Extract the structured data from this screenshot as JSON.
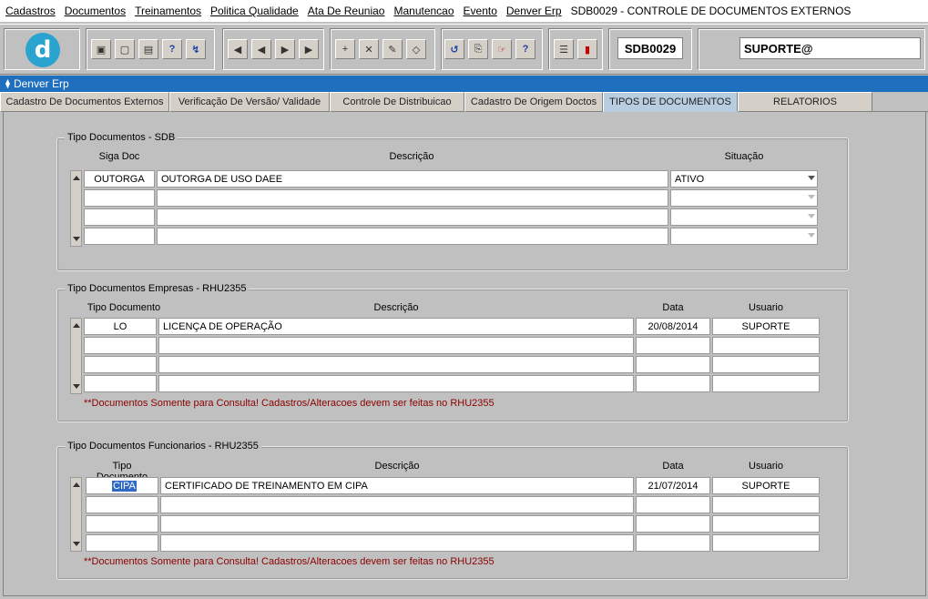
{
  "menu": {
    "items": [
      "Cadastros",
      "Documentos",
      "Treinamentos",
      "Politica Qualidade",
      "Ata De Reuniao",
      "Manutencao",
      "Evento",
      "Denver Erp"
    ],
    "form_title": "SDB0029 - CONTROLE DE DOCUMENTOS EXTERNOS"
  },
  "toolbar": {
    "logo_letter": "d",
    "form_code": "SDB0029",
    "user": "SUPORTE@"
  },
  "window": {
    "title": "Denver Erp"
  },
  "tabs": [
    "Cadastro De Documentos Externos",
    "Verificação De Versão/ Validade",
    "Controle De Distribuicao",
    "Cadastro De Origem Doctos",
    "TIPOS DE DOCUMENTOS",
    "RELATORIOS"
  ],
  "active_tab": "TIPOS DE DOCUMENTOS",
  "sdb": {
    "title": "Tipo Documentos - SDB",
    "headers": {
      "code": "Siga Doc",
      "desc": "Descrição",
      "status": "Situação"
    },
    "rows": [
      {
        "code": "OUTORGA",
        "desc": "OUTORGA DE USO DAEE",
        "status": "ATIVO"
      }
    ]
  },
  "empresas": {
    "title": "Tipo Documentos Empresas - RHU2355",
    "headers": {
      "code": "Tipo Documento",
      "desc": "Descrição",
      "date": "Data",
      "user": "Usuario"
    },
    "rows": [
      {
        "code": "LO",
        "desc": "LICENÇA DE OPERAÇÃO",
        "date": "20/08/2014",
        "user": "SUPORTE"
      }
    ],
    "note": "**Documentos Somente para Consulta! Cadastros/Alteracoes devem ser feitas no RHU2355"
  },
  "funcionarios": {
    "title": "Tipo Documentos Funcionarios - RHU2355",
    "headers": {
      "code": "Tipo Documento",
      "desc": "Descrição",
      "date": "Data",
      "user": "Usuario"
    },
    "rows": [
      {
        "code": "CIPA",
        "desc": "CERTIFICADO DE TREINAMENTO EM CIPA",
        "date": "21/07/2014",
        "user": "SUPORTE"
      }
    ],
    "note": "**Documentos Somente para Consulta! Cadastros/Alteracoes devem ser feitas no RHU2355"
  },
  "icons": [
    "save-icon",
    "window-icon",
    "print-icon",
    "query-icon",
    "execute-query-icon",
    "first-record-icon",
    "previous-record-icon",
    "next-record-icon",
    "last-record-icon",
    "insert-record-icon",
    "delete-record-icon",
    "edit-icon",
    "clear-icon",
    "undo-icon",
    "clipboard-icon",
    "tools-icon",
    "help-icon",
    "menu-icon",
    "exit-icon"
  ],
  "colors": {
    "title_bar": "#1f6fbf",
    "active_tab": "#b8cde0",
    "note": "#8b0000",
    "logo": "#2aa3cf"
  }
}
